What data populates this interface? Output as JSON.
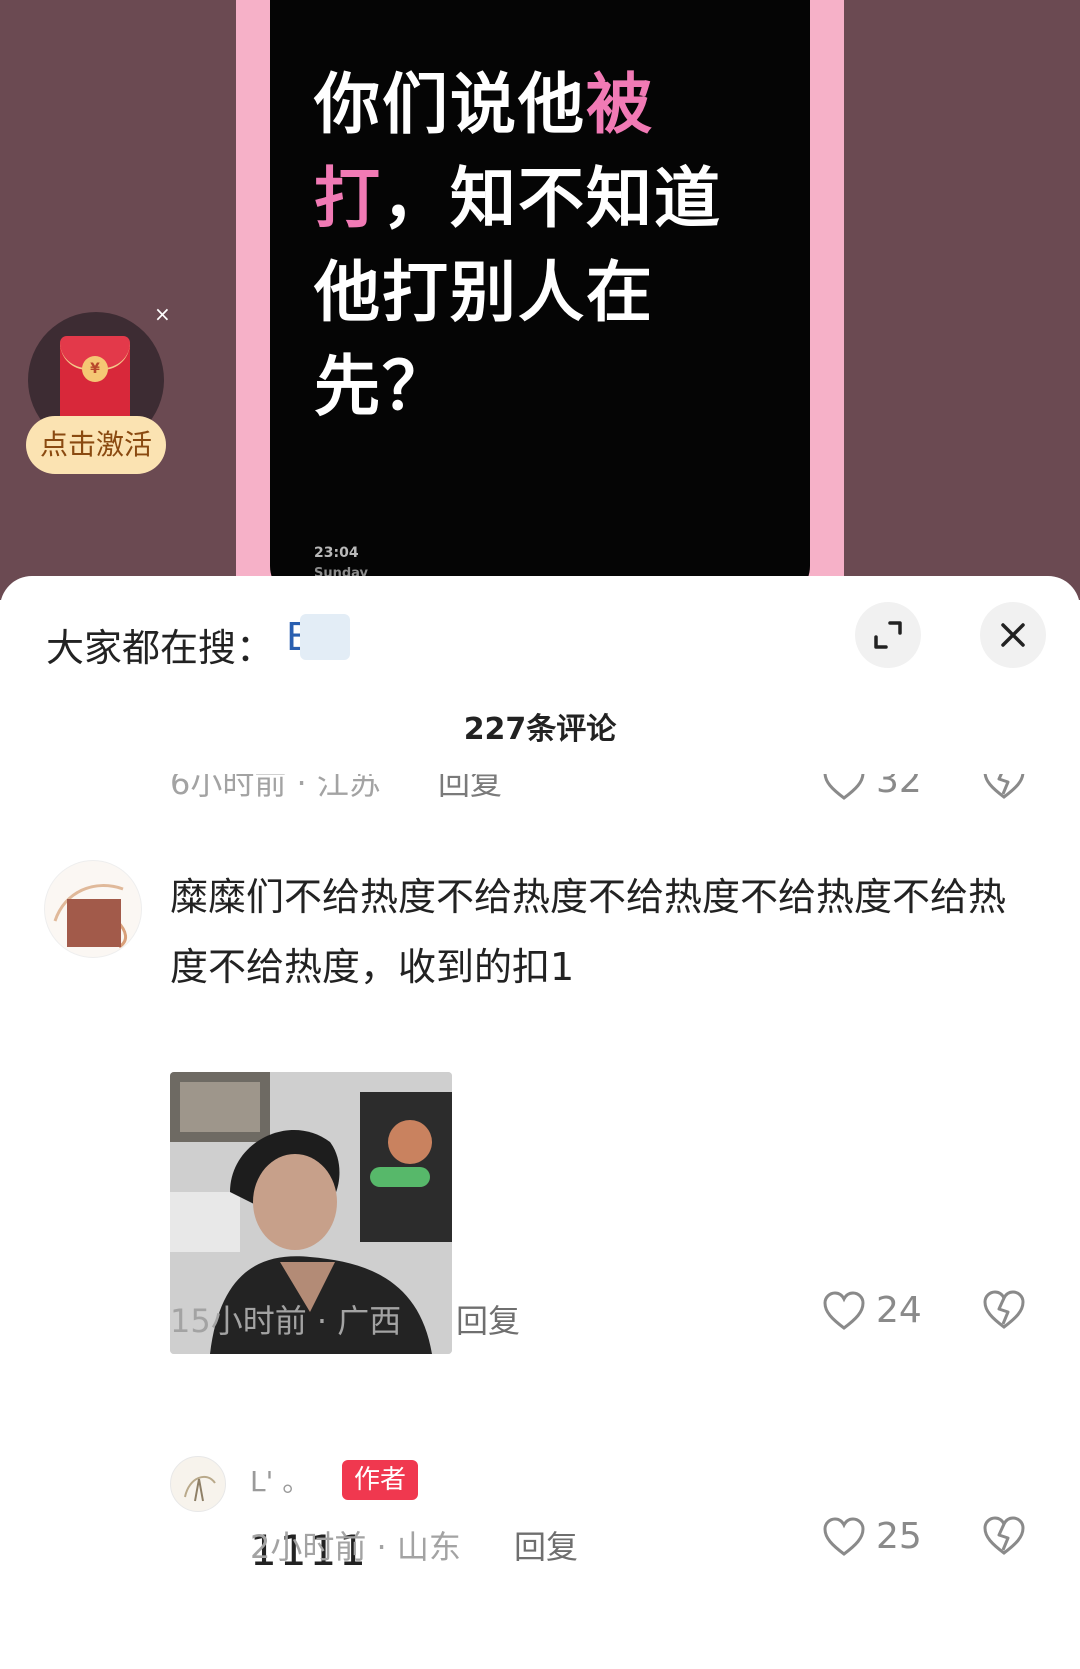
{
  "video": {
    "headline_lines": [
      {
        "a": "你们说他",
        "b": "被"
      },
      {
        "a": "打",
        "b": "，知不知道"
      },
      {
        "a": "他打别人在",
        "b": ""
      },
      {
        "a": "先？",
        "b": ""
      }
    ],
    "card_time": "23:04",
    "card_day": "Sunday",
    "colors": {
      "highlight": "#f17ab5",
      "frame": "#f6b1c8",
      "background": "#6b4a52"
    }
  },
  "red_packet": {
    "button_label": "点击激活",
    "close_glyph": "×",
    "coin_glyph": "¥"
  },
  "sheet": {
    "search_prefix": "大家都在搜：",
    "search_term": "B   ?",
    "comment_count": "227条评论"
  },
  "partial_comment": {
    "time_location": "6小时前 · 江苏",
    "reply_label": "回复",
    "likes": "32"
  },
  "comment": {
    "text": "糜糜们不给热度不给热度不给热度不给热度不给热度不给热度，收到的扣1",
    "time_location": "15小时前 · 广西",
    "reply_label": "回复",
    "likes": "24"
  },
  "reply": {
    "name": "L' 。",
    "badge": "作者",
    "text": "1111",
    "time_location": "2小时前 · 山东",
    "reply_label": "回复",
    "likes": "25"
  }
}
